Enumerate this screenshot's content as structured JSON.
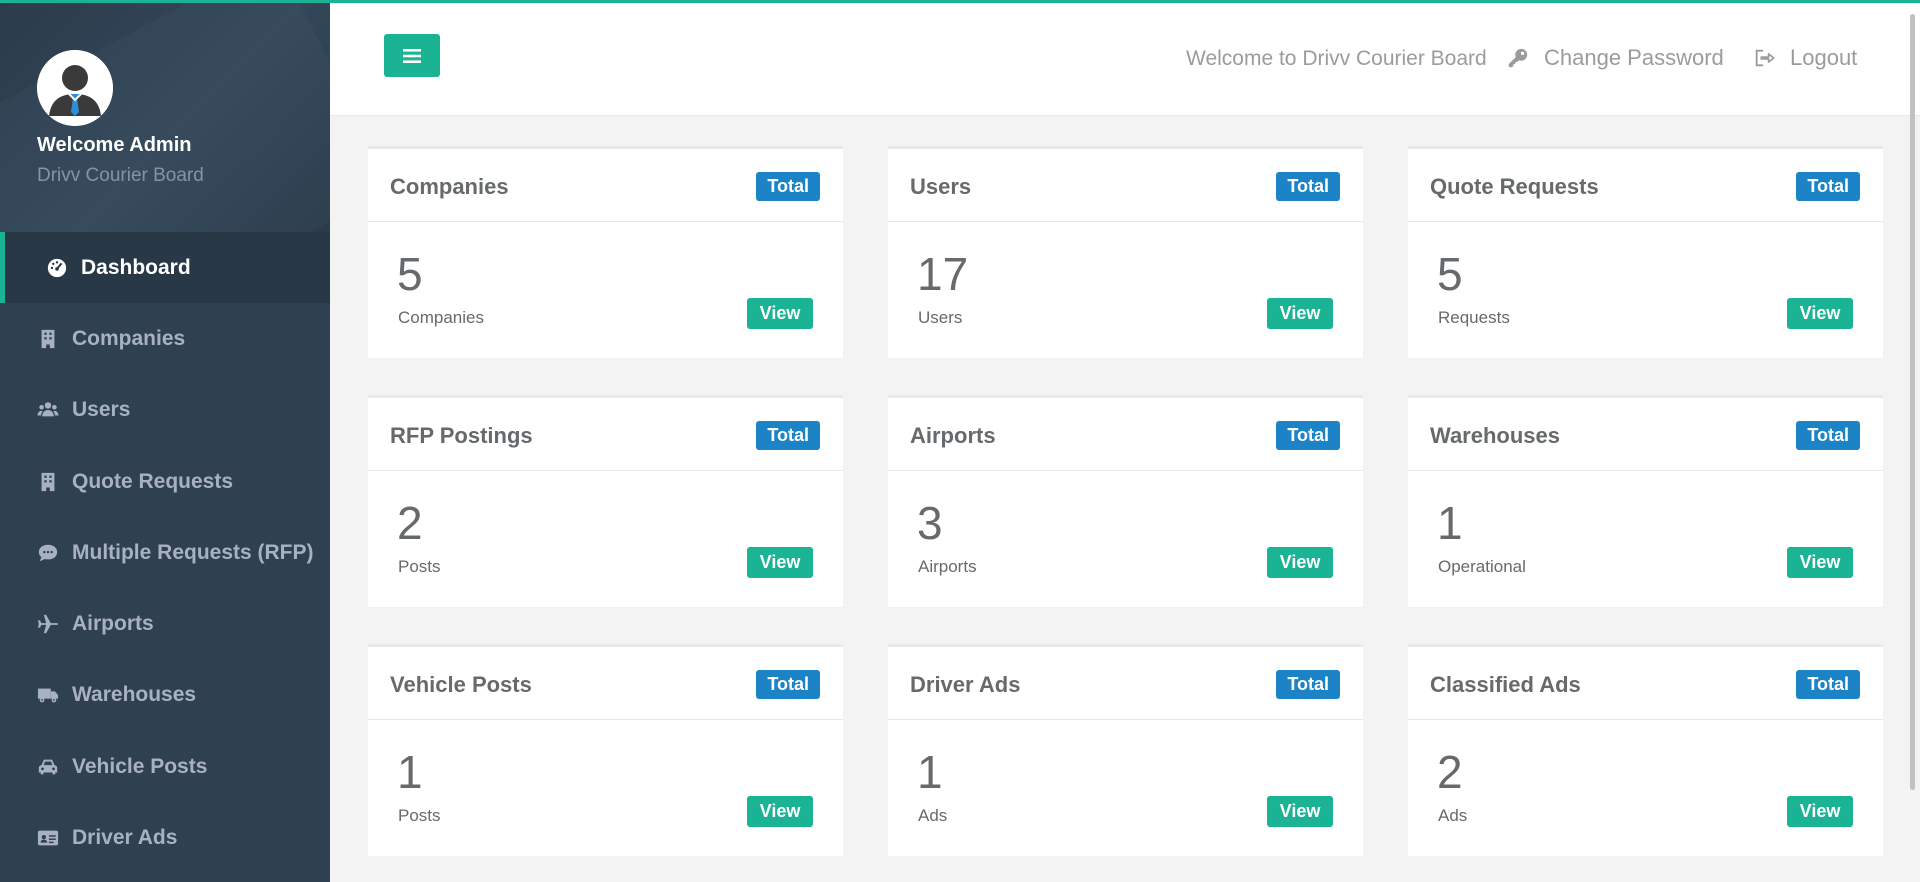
{
  "sidebar": {
    "welcome": "Welcome Admin",
    "subtitle": "Drivv Courier Board",
    "items": [
      {
        "label": "Dashboard",
        "icon": "dashboard-icon"
      },
      {
        "label": "Companies",
        "icon": "building-icon"
      },
      {
        "label": "Users",
        "icon": "users-icon"
      },
      {
        "label": "Quote Requests",
        "icon": "building-icon"
      },
      {
        "label": "Multiple Requests (RFP)",
        "icon": "comment-icon"
      },
      {
        "label": "Airports",
        "icon": "plane-icon"
      },
      {
        "label": "Warehouses",
        "icon": "truck-icon"
      },
      {
        "label": "Vehicle Posts",
        "icon": "car-icon"
      },
      {
        "label": "Driver Ads",
        "icon": "id-card-icon"
      }
    ]
  },
  "header": {
    "welcome": "Welcome to Drivv Courier Board",
    "change_password": "Change Password",
    "logout": "Logout"
  },
  "cards": [
    {
      "title": "Companies",
      "badge": "Total",
      "count": "5",
      "sub": "Companies",
      "button": "View"
    },
    {
      "title": "Users",
      "badge": "Total",
      "count": "17",
      "sub": "Users",
      "button": "View"
    },
    {
      "title": "Quote Requests",
      "badge": "Total",
      "count": "5",
      "sub": "Requests",
      "button": "View"
    },
    {
      "title": "RFP Postings",
      "badge": "Total",
      "count": "2",
      "sub": "Posts",
      "button": "View"
    },
    {
      "title": "Airports",
      "badge": "Total",
      "count": "3",
      "sub": "Airports",
      "button": "View"
    },
    {
      "title": "Warehouses",
      "badge": "Total",
      "count": "1",
      "sub": "Operational",
      "button": "View"
    },
    {
      "title": "Vehicle Posts",
      "badge": "Total",
      "count": "1",
      "sub": "Posts",
      "button": "View"
    },
    {
      "title": "Driver Ads",
      "badge": "Total",
      "count": "1",
      "sub": "Ads",
      "button": "View"
    },
    {
      "title": "Classified Ads",
      "badge": "Total",
      "count": "2",
      "sub": "Ads",
      "button": "View"
    }
  ],
  "colors": {
    "accent": "#1ab394",
    "badge": "#1c84c6",
    "sidebar": "#2f4050"
  }
}
